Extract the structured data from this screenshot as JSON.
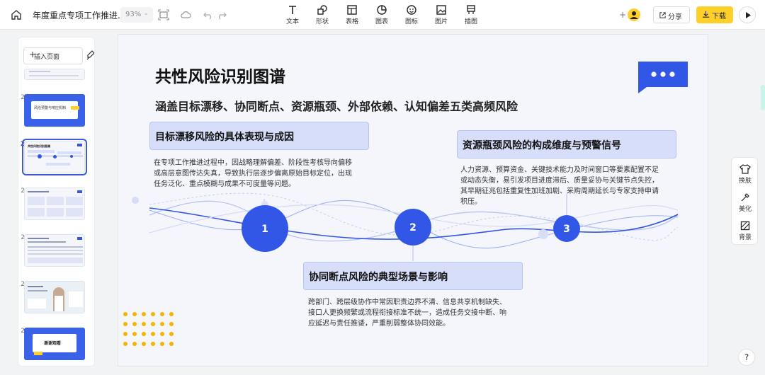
{
  "topbar": {
    "doc_title": "年度重点专项工作推进...",
    "zoom": "93%",
    "tools": [
      {
        "label": "文本",
        "icon": "text-icon"
      },
      {
        "label": "形状",
        "icon": "shape-icon"
      },
      {
        "label": "表格",
        "icon": "table-icon"
      },
      {
        "label": "图表",
        "icon": "chart-icon"
      },
      {
        "label": "图标",
        "icon": "emoji-icon"
      },
      {
        "label": "图片",
        "icon": "image-icon"
      },
      {
        "label": "插图",
        "icon": "illustration-icon"
      }
    ],
    "share_label": "分享",
    "download_label": "下载"
  },
  "sidebar": {
    "insert_label": "插入页面",
    "slides": [
      {
        "num": "21",
        "title": "风险预警与响应机制"
      },
      {
        "num": "22",
        "title": "共性风险识别图谱"
      },
      {
        "num": "23",
        "title": ""
      },
      {
        "num": "24",
        "title": ""
      },
      {
        "num": "25",
        "title": ""
      },
      {
        "num": "26",
        "title": "谢谢观看"
      }
    ],
    "active_slide": "22"
  },
  "slide": {
    "title": "共性风险识别图谱",
    "subtitle": "涵盖目标漂移、协同断点、资源瓶颈、外部依赖、认知偏差五类高频风险",
    "sections": [
      {
        "num": "1",
        "heading": "目标漂移风险的具体表现与成因",
        "lines": [
          "在专项工作推进过程中，因战略理解偏差、阶段性考核导向偏移",
          "或高层意图传达失真，导致执行层逐步偏离原始目标定位，出现",
          "任务泛化、重点模糊与成果不可度量等问题。"
        ]
      },
      {
        "num": "2",
        "heading": "协同断点风险的典型场景与影响",
        "lines": [
          "跨部门、跨层级协作中常因职责边界不清、信息共享机制缺失、",
          "接口人更换频繁或流程衔接标准不统一，造成任务交接中断、响",
          "应延迟与责任推诿，严重削弱整体协同效能。"
        ]
      },
      {
        "num": "3",
        "heading": "资源瓶颈风险的构成维度与预警信号",
        "lines": [
          "人力资源、预算资金、关键技术能力及时间窗口等要素配置不足",
          "或动态失衡，易引发项目进度滞后、质量妥协与关键节点失控，",
          "其早期征兆包括重复性加班加剧、采购周期延长与专家支持申请",
          "积压。"
        ]
      }
    ]
  },
  "rightbar": {
    "items": [
      {
        "label": "换肤",
        "icon": "shirt-icon"
      },
      {
        "label": "美化",
        "icon": "magic-wand-icon"
      },
      {
        "label": "背景",
        "icon": "background-icon"
      }
    ]
  },
  "help_label": "?",
  "colors": {
    "accent": "#3257e6",
    "download": "#ffd02a",
    "section_fill": "#d7def9",
    "dots": "#f5b400"
  }
}
